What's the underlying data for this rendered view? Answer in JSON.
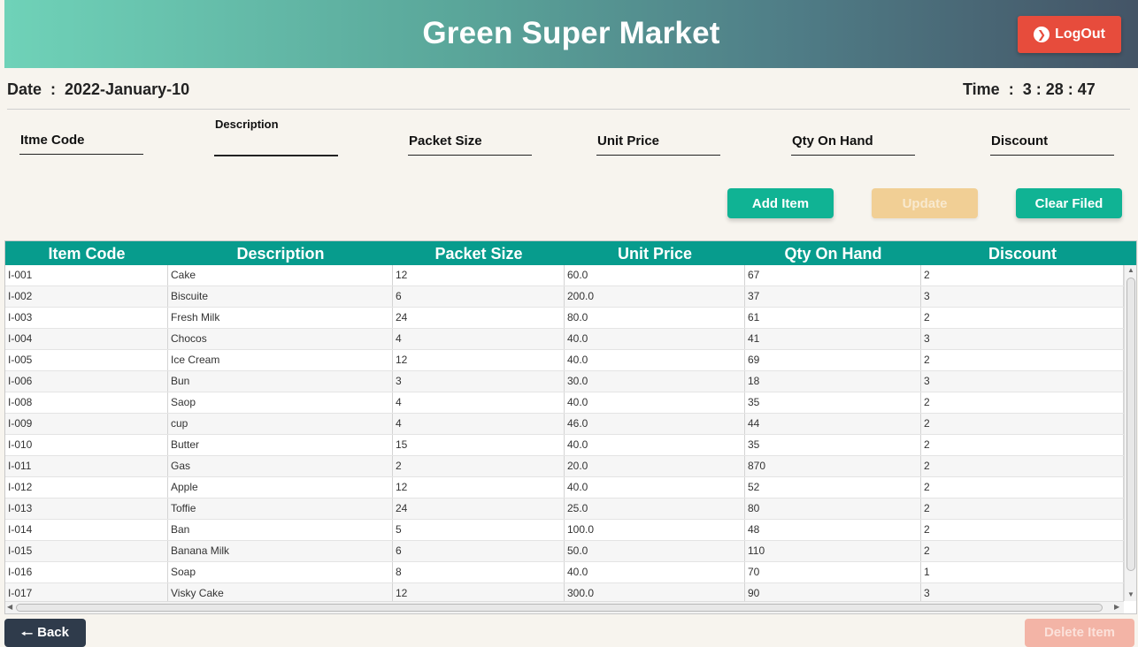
{
  "header": {
    "title": "Green Super Market",
    "logout_label": "LogOut",
    "logout_icon": "chevron-right-circle-icon"
  },
  "info": {
    "date_label": "Date",
    "date_value": "2022-January-10",
    "time_label": "Time",
    "time_value": "3 : 28 : 47",
    "separator": ":"
  },
  "form": {
    "item_code_label": "Itme Code",
    "description_label": "Description",
    "packet_size_label": "Packet Size",
    "unit_price_label": "Unit Price",
    "qty_on_hand_label": "Qty On Hand",
    "discount_label": "Discount"
  },
  "actions": {
    "add_label": "Add Item",
    "update_label": "Update",
    "clear_label": "Clear Filed",
    "back_label": "Back",
    "delete_label": "Delete Item"
  },
  "table": {
    "columns": [
      "Item Code",
      "Description",
      "Packet Size",
      "Unit Price",
      "Qty On Hand",
      "Discount"
    ],
    "rows": [
      [
        "I-001",
        "Cake",
        "12",
        "60.0",
        "67",
        "2"
      ],
      [
        "I-002",
        "Biscuite",
        "6",
        "200.0",
        "37",
        "3"
      ],
      [
        "I-003",
        "Fresh Milk",
        "24",
        "80.0",
        "61",
        "2"
      ],
      [
        "I-004",
        "Chocos",
        "4",
        "40.0",
        "41",
        "3"
      ],
      [
        "I-005",
        "Ice Cream",
        "12",
        "40.0",
        "69",
        "2"
      ],
      [
        "I-006",
        "Bun",
        "3",
        "30.0",
        "18",
        "3"
      ],
      [
        "I-008",
        "Saop",
        "4",
        "40.0",
        "35",
        "2"
      ],
      [
        "I-009",
        "cup",
        "4",
        "46.0",
        "44",
        "2"
      ],
      [
        "I-010",
        "Butter",
        "15",
        "40.0",
        "35",
        "2"
      ],
      [
        "I-011",
        "Gas",
        "2",
        "20.0",
        "870",
        "2"
      ],
      [
        "I-012",
        "Apple",
        "12",
        "40.0",
        "52",
        "2"
      ],
      [
        "I-013",
        "Toffie",
        "24",
        "25.0",
        "80",
        "2"
      ],
      [
        "I-014",
        "Ban",
        "5",
        "100.0",
        "48",
        "2"
      ],
      [
        "I-015",
        "Banana Milk",
        "6",
        "50.0",
        "110",
        "2"
      ],
      [
        "I-016",
        "Soap",
        "8",
        "40.0",
        "70",
        "1"
      ],
      [
        "I-017",
        "Visky Cake",
        "12",
        "300.0",
        "90",
        "3"
      ]
    ]
  },
  "colors": {
    "accent_green": "#10b394",
    "table_header": "#079c8d",
    "logout_red": "#e74c3c",
    "back_dark": "#2f3b4b"
  }
}
